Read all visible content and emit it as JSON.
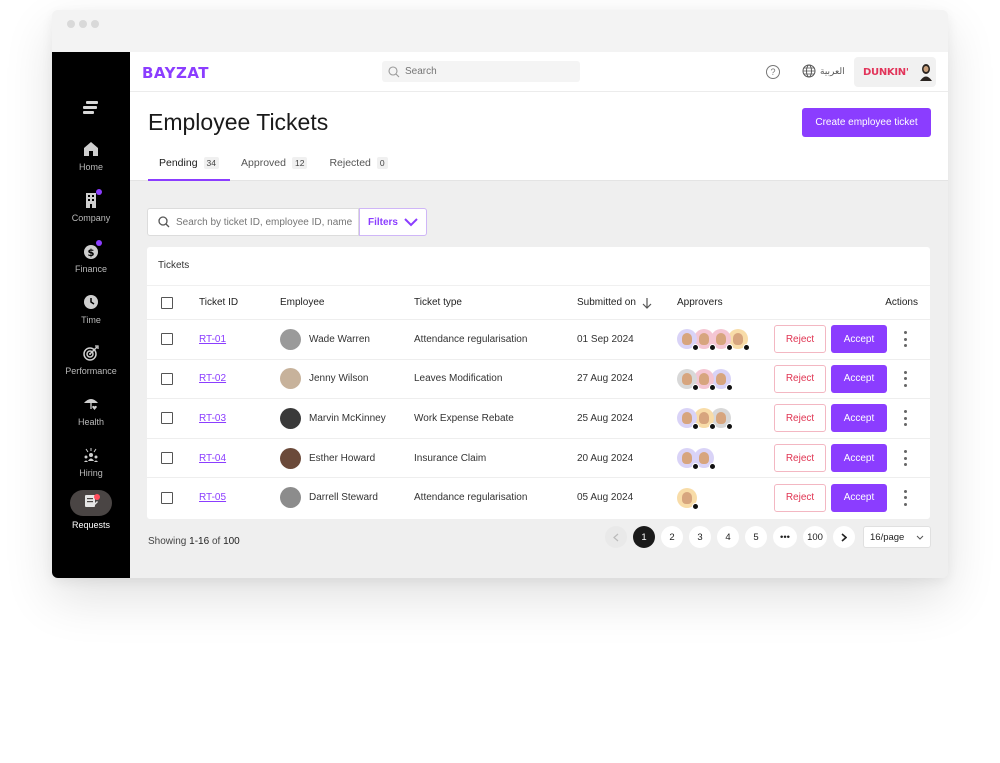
{
  "window": {
    "controls": [
      "close",
      "minimize",
      "maximize"
    ]
  },
  "sidebar": {
    "menu_icon": "menu-icon",
    "items": [
      {
        "label": "Home",
        "icon": "home-icon",
        "badge": false,
        "active": false
      },
      {
        "label": "Company",
        "icon": "building-icon",
        "badge": true,
        "active": false
      },
      {
        "label": "Finance",
        "icon": "dollar-icon",
        "badge": true,
        "active": false
      },
      {
        "label": "Time",
        "icon": "clock-icon",
        "badge": false,
        "active": false
      },
      {
        "label": "Performance",
        "icon": "target-icon",
        "badge": false,
        "active": false
      },
      {
        "label": "Health",
        "icon": "umbrella-heart-icon",
        "badge": false,
        "active": false
      },
      {
        "label": "Hiring",
        "icon": "people-icon",
        "badge": false,
        "active": false
      },
      {
        "label": "Requests",
        "icon": "clipboard-edit-icon",
        "badge": true,
        "active": true
      }
    ]
  },
  "topbar": {
    "logo": "BAYZAT",
    "search_placeholder": "Search",
    "help_icon": "?",
    "language": "العربية",
    "company": "DUNKIN'"
  },
  "header": {
    "title": "Employee Tickets",
    "create_button": "Create employee ticket",
    "tabs": [
      {
        "label": "Pending",
        "count": "34",
        "active": true
      },
      {
        "label": "Approved",
        "count": "12",
        "active": false
      },
      {
        "label": "Rejected",
        "count": "0",
        "active": false
      }
    ]
  },
  "toolbar": {
    "search_placeholder": "Search by ticket ID, employee ID, name",
    "filters_label": "Filters"
  },
  "table": {
    "title": "Tickets",
    "columns": {
      "ticket_id": "Ticket ID",
      "employee": "Employee",
      "ticket_type": "Ticket type",
      "submitted_on": "Submitted on",
      "approvers": "Approvers",
      "actions": "Actions"
    },
    "reject_label": "Reject",
    "accept_label": "Accept",
    "rows": [
      {
        "id": "RT-01",
        "employee": "Wade Warren",
        "type": "Attendance regularisation",
        "date": "01 Sep 2024",
        "approvers": [
          "#d9d3f7",
          "#f4c6d3",
          "#f4c6d3",
          "#f8dca8"
        ]
      },
      {
        "id": "RT-02",
        "employee": "Jenny Wilson",
        "type": "Leaves Modification",
        "date": "27 Aug 2024",
        "approvers": [
          "#d8d8d8",
          "#f4c6d3",
          "#d9d3f7"
        ]
      },
      {
        "id": "RT-03",
        "employee": "Marvin McKinney",
        "type": "Work Expense Rebate",
        "date": "25 Aug 2024",
        "approvers": [
          "#d9d3f7",
          "#f8dca8",
          "#d8d8d8"
        ]
      },
      {
        "id": "RT-04",
        "employee": "Esther Howard",
        "type": "Insurance Claim",
        "date": "20 Aug 2024",
        "approvers": [
          "#d9d3f7",
          "#d9d3f7"
        ]
      },
      {
        "id": "RT-05",
        "employee": "Darrell Steward",
        "type": "Attendance regularisation",
        "date": "05 Aug 2024",
        "approvers": [
          "#f8dca8"
        ]
      }
    ]
  },
  "footer": {
    "showing_prefix": "Showing",
    "showing_range": "1-16",
    "showing_of": "of",
    "showing_total": "100",
    "pages": [
      "1",
      "2",
      "3",
      "4",
      "5",
      "•••",
      "100"
    ],
    "current_page": "1",
    "per_page": "16/page"
  },
  "colors": {
    "accent": "#8b3dff",
    "danger": "#e03452",
    "sidebar_bg": "#000000"
  }
}
